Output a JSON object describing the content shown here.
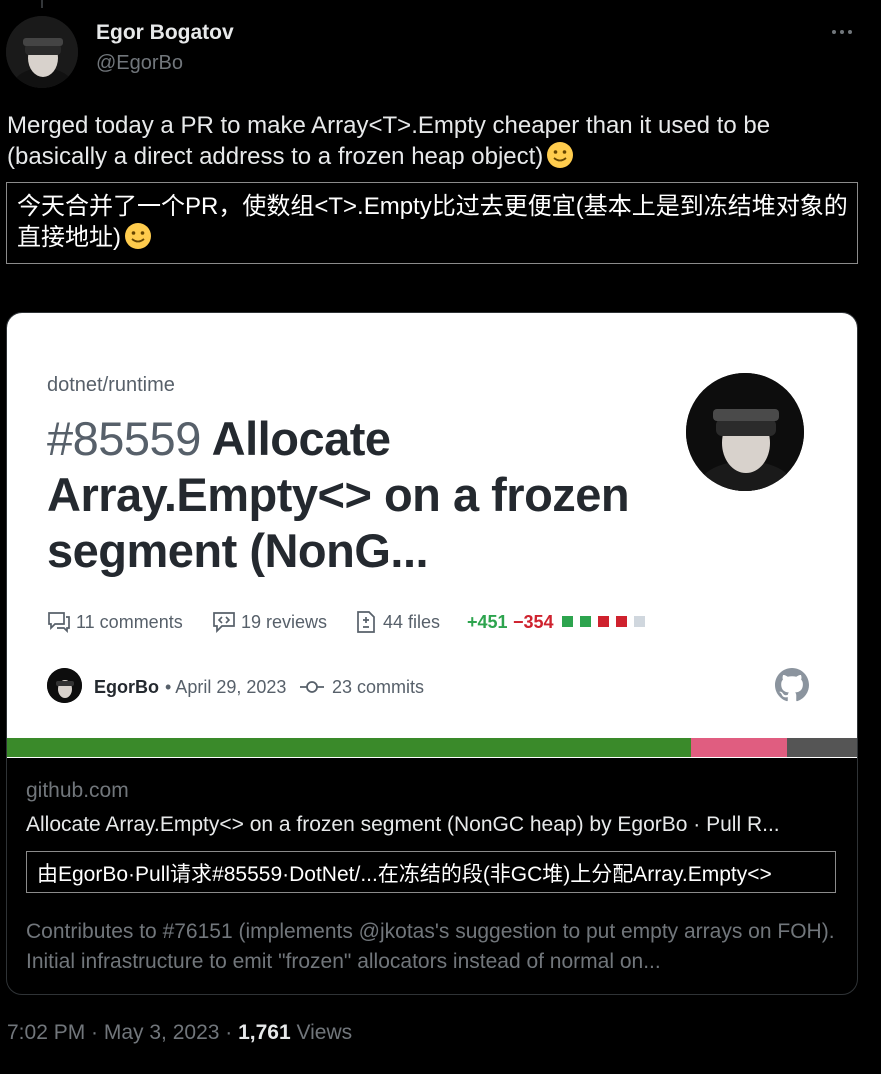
{
  "author": {
    "name": "Egor Bogatov",
    "handle": "@EgorBo"
  },
  "tweet": {
    "text": "Merged today a PR to make Array<T>.Empty cheaper than it used to be (basically a direct address to a frozen heap object)",
    "translation": "今天合并了一个PR，使数组<T>.Empty比过去更便宜(基本上是到冻结堆对象的直接地址)"
  },
  "card": {
    "repo": "dotnet/runtime",
    "pr_number": "#85559",
    "pr_title": "Allocate Array.Empty<> on a frozen segment (NonG...",
    "stats": {
      "comments": "11 comments",
      "reviews": "19 reviews",
      "files": "44 files",
      "additions": "+451",
      "deletions": "−354",
      "diff_squares": [
        "#2da44e",
        "#2da44e",
        "#cf222e",
        "#cf222e",
        "#d0d7de"
      ]
    },
    "meta": {
      "user": "EgorBo",
      "date": "• April 29, 2023",
      "commits": "23 commits"
    },
    "lang_bar": [
      {
        "color": "#3a8a2a",
        "share": 0.805
      },
      {
        "color": "#e05d80",
        "share": 0.113
      },
      {
        "color": "#555555",
        "share": 0.082
      }
    ],
    "domain": "github.com",
    "link_title": "Allocate Array.Empty<> on a frozen segment (NonGC heap) by EgorBo · Pull R...",
    "link_translation": "由EgorBo·Pull请求#85559·DotNet/...在冻结的段(非GC堆)上分配Array.Empty<>",
    "description": "Contributes to #76151 (implements @jkotas's suggestion to put empty arrays on FOH). Initial infrastructure to emit \"frozen\" allocators instead of normal on..."
  },
  "footer": {
    "time": "7:02 PM · May 3, 2023 · ",
    "views_count": "1,761",
    "views_label": " Views"
  },
  "icons": {
    "more": "more-dots-icon",
    "comment": "comment-icon",
    "review": "review-icon",
    "file": "file-diff-icon",
    "commit": "commit-icon",
    "github": "github-icon",
    "emoji": "slightly-smiling-face-emoji"
  }
}
